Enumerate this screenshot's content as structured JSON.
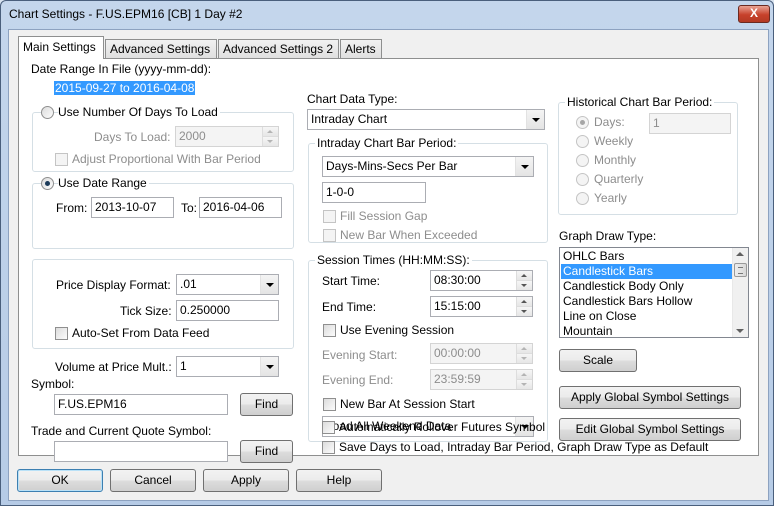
{
  "window": {
    "title": "Chart Settings - F.US.EPM16 [CB]  1 Day   #2",
    "close_label": "X"
  },
  "tabs": [
    {
      "label": "Main Settings"
    },
    {
      "label": "Advanced Settings"
    },
    {
      "label": "Advanced Settings 2"
    },
    {
      "label": "Alerts"
    }
  ],
  "date_range": {
    "label": "Date Range In File (yyyy-mm-dd):",
    "value": "2015-09-27 to 2016-04-08"
  },
  "days_group": {
    "radio_label": "Use Number Of Days To Load",
    "days_label": "Days To Load:",
    "days_value": "2000",
    "adjust_label": "Adjust Proportional With Bar Period"
  },
  "date_group": {
    "radio_label": "Use Date Range",
    "from_label": "From:",
    "from_value": "2013-10-07",
    "to_label": "To:",
    "to_value": "2016-04-06"
  },
  "price_group": {
    "format_label": "Price Display Format:",
    "format_value": ".01",
    "tick_label": "Tick Size:",
    "tick_value": "0.250000",
    "autoset_label": "Auto-Set From Data Feed"
  },
  "volume": {
    "label": "Volume at Price Mult.:",
    "value": "1"
  },
  "symbol": {
    "label": "Symbol:",
    "value": "F.US.EPM16",
    "find_label": "Find"
  },
  "trade_symbol": {
    "label": "Trade and Current Quote Symbol:",
    "value": "",
    "find_label": "Find"
  },
  "chart_data_type": {
    "label": "Chart Data Type:",
    "value": "Intraday Chart"
  },
  "intraday": {
    "legend": "Intraday Chart Bar Period:",
    "type_value": "Days-Mins-Secs Per Bar",
    "period_value": "1-0-0",
    "fill_gap_label": "Fill Session Gap",
    "new_bar_label": "New Bar When Exceeded"
  },
  "session": {
    "legend": "Session Times (HH:MM:SS):",
    "start_label": "Start Time:",
    "start_value": "08:30:00",
    "end_label": "End Time:",
    "end_value": "15:15:00",
    "evening_label": "Use Evening Session",
    "evening_start_label": "Evening Start:",
    "evening_start_value": "00:00:00",
    "evening_end_label": "Evening End:",
    "evening_end_value": "23:59:59",
    "new_bar_start_label": "New Bar At Session Start",
    "weekend_value": "Load All Weekend Data"
  },
  "options": {
    "rollover_label": "Automatically Rollover Futures Symbol",
    "save_default_label": "Save Days to Load, Intraday Bar Period, Graph Draw Type as Default"
  },
  "historical": {
    "legend": "Historical Chart Bar Period:",
    "days_label": "Days:",
    "days_value": "1",
    "options": [
      "Weekly",
      "Monthly",
      "Quarterly",
      "Yearly"
    ]
  },
  "graph_draw": {
    "label": "Graph Draw Type:",
    "items": [
      "OHLC Bars",
      "Candlestick Bars",
      "Candlestick Body Only",
      "Candlestick Bars Hollow",
      "Line on Close",
      "Mountain"
    ],
    "selected": "Candlestick Bars"
  },
  "buttons": {
    "scale": "Scale",
    "apply_global": "Apply Global Symbol Settings",
    "edit_global": "Edit Global Symbol Settings",
    "ok": "OK",
    "cancel": "Cancel",
    "apply": "Apply",
    "help": "Help"
  }
}
